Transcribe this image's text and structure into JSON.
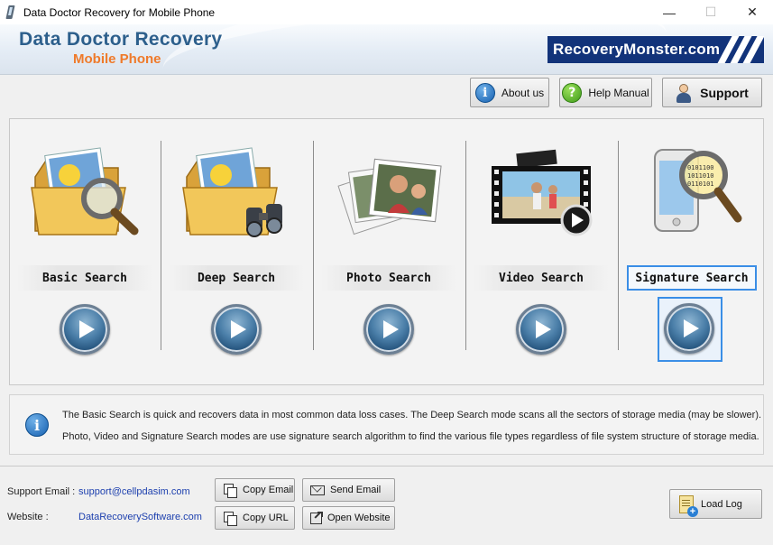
{
  "window": {
    "title": "Data Doctor Recovery for Mobile Phone",
    "minimize_glyph": "—",
    "maximize_glyph": "☐",
    "close_glyph": "✕"
  },
  "header": {
    "brand_title": "Data Doctor Recovery",
    "brand_subtitle": "Mobile Phone",
    "logo_text": "RecoveryMonster.com"
  },
  "toolbar": {
    "about_label": "About us",
    "help_label": "Help Manual",
    "support_label": "Support",
    "info_glyph": "i",
    "help_glyph": "?"
  },
  "search_modes": [
    {
      "label": "Basic Search",
      "icon": "folder-magnifier-icon"
    },
    {
      "label": "Deep Search",
      "icon": "folder-binoculars-icon"
    },
    {
      "label": "Photo Search",
      "icon": "photo-stack-icon"
    },
    {
      "label": "Video Search",
      "icon": "video-filmstrip-icon"
    },
    {
      "label": "Signature Search",
      "icon": "phone-magnifier-icon",
      "selected": true
    }
  ],
  "info": {
    "glyph": "i",
    "line1": "The Basic Search is quick and recovers data in most common data loss cases. The Deep Search mode scans all the sectors of storage media (may be slower).",
    "line2": "Photo, Video and Signature Search modes are use signature search algorithm to find the various file types regardless of file system structure of storage media."
  },
  "footer": {
    "support_email_label": "Support Email :",
    "support_email": "support@cellpdasim.com",
    "website_label": "Website :",
    "website": "DataRecoverySoftware.com",
    "copy_email_label": "Copy Email",
    "send_email_label": "Send Email",
    "copy_url_label": "Copy URL",
    "open_website_label": "Open Website",
    "load_log_label": "Load Log"
  },
  "colors": {
    "brand_blue": "#2d5f8c",
    "brand_orange": "#ef7a2a",
    "logo_bg": "#12337a",
    "selection_blue": "#3a8ee6",
    "link_blue": "#1c3fae"
  }
}
